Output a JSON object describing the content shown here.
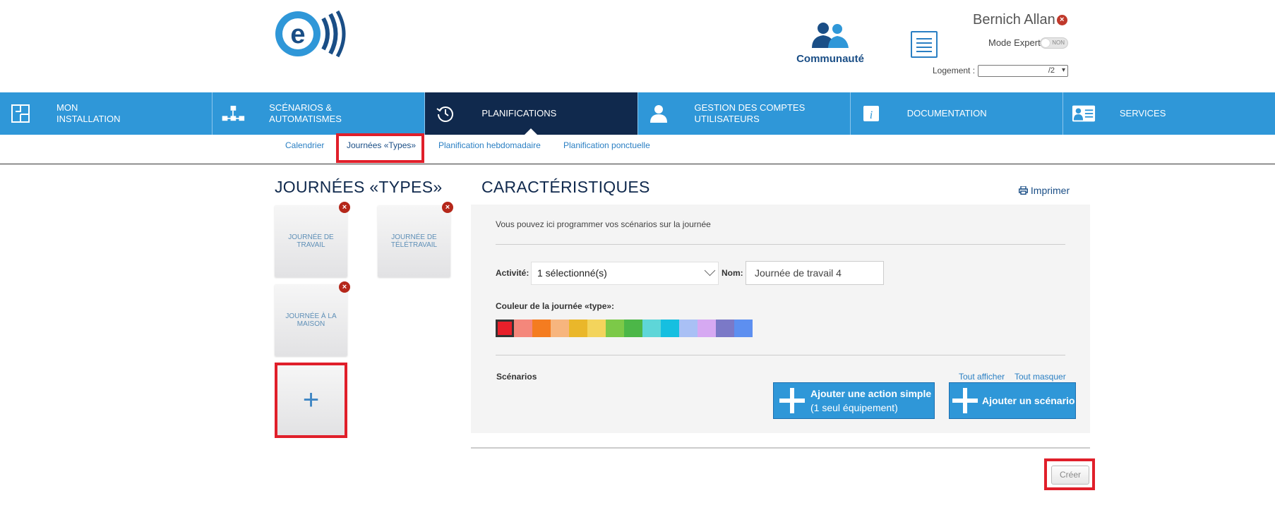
{
  "header": {
    "user_name": "Bernich Allan",
    "expert_mode_label": "Mode Expert",
    "expert_mode_state": "NON",
    "logement_label": "Logement :",
    "logement_value": "/2",
    "community_label": "Communauté"
  },
  "nav": {
    "items": [
      {
        "label": "MON\nINSTALLATION",
        "icon": "floorplan-icon"
      },
      {
        "label": "SCÉNARIOS &\nAUTOMATISMES",
        "icon": "network-icon"
      },
      {
        "label": "PLANIFICATIONS",
        "icon": "history-clock-icon",
        "active": true
      },
      {
        "label": "GESTION DES COMPTES\nUTILISATEURS",
        "icon": "user-icon"
      },
      {
        "label": "DOCUMENTATION",
        "icon": "info-icon"
      },
      {
        "label": "SERVICES",
        "icon": "services-icon"
      }
    ]
  },
  "subnav": {
    "items": [
      "Calendrier",
      "Journées «Types»",
      "Planification hebdomadaire",
      "Planification ponctuelle"
    ],
    "active_index": 1
  },
  "left": {
    "title": "JOURNÉES «TYPES»",
    "cards": [
      "JOURNÉE DE TRAVAIL",
      "JOURNÉE DE TÉLÉTRAVAIL",
      "JOURNÉE À LA MAISON"
    ],
    "add_symbol": "+"
  },
  "main": {
    "title": "CARACTÉRISTIQUES",
    "print_label": "Imprimer",
    "intro": "Vous pouvez ici programmer vos scénarios sur la journée",
    "activity_label": "Activité:",
    "activity_value": "1 sélectionné(s)",
    "nom_label": "Nom:",
    "nom_value": "Journée de travail 4",
    "color_label": "Couleur de la journée «type»:",
    "colors": [
      "#e8202a",
      "#f4877b",
      "#f47c20",
      "#f7b57e",
      "#eab72a",
      "#f3d45c",
      "#7cc948",
      "#4cb748",
      "#5ed6d8",
      "#16bfe0",
      "#a9c0f5",
      "#d6a9f2",
      "#7b79c7",
      "#5d8ff0"
    ],
    "selected_color_index": 0,
    "scenarios_label": "Scénarios",
    "show_all": "Tout afficher",
    "hide_all": "Tout masquer",
    "btn_simple_line1": "Ajouter une action simple",
    "btn_simple_line2": "(1 seul équipement)",
    "btn_scenario": "Ajouter un scénario",
    "create_label": "Créer"
  }
}
